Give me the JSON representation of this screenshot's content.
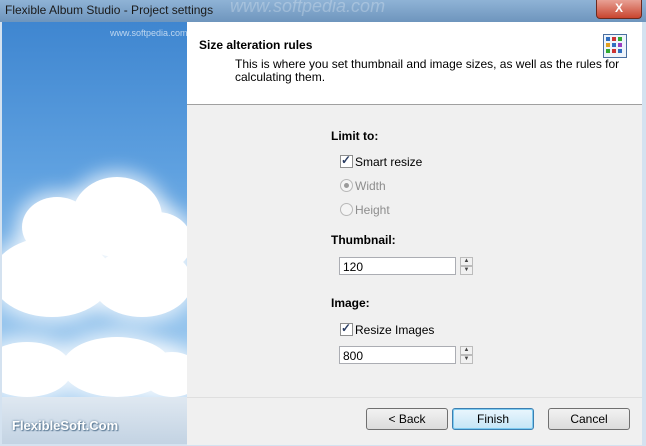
{
  "window": {
    "title": "Flexible Album Studio - Project settings",
    "close_glyph": "X",
    "watermark_top": "www.softpedia.com"
  },
  "sidebar": {
    "watermark": "www.softpedia.com",
    "brand": "FlexibleSoft.Com"
  },
  "header": {
    "title": "Size alteration rules",
    "description": "This is where you set thumbnail and image sizes, as well as the rules for calculating them.",
    "icon": "album-grid-icon"
  },
  "limit": {
    "label": "Limit to:",
    "smart_resize": {
      "label": "Smart resize",
      "checked": true
    },
    "width": {
      "label": "Width",
      "selected": true,
      "enabled": false
    },
    "height": {
      "label": "Height",
      "selected": false,
      "enabled": false
    }
  },
  "thumbnail": {
    "label": "Thumbnail:",
    "value": "120"
  },
  "image": {
    "label": "Image:",
    "resize_images": {
      "label": "Resize Images",
      "checked": true
    },
    "value": "800"
  },
  "buttons": {
    "back": "< Back",
    "finish": "Finish",
    "cancel": "Cancel"
  },
  "colors": {
    "accent": "#3c7fb1",
    "sky": "#5fa1e0",
    "close": "#c9452f"
  }
}
